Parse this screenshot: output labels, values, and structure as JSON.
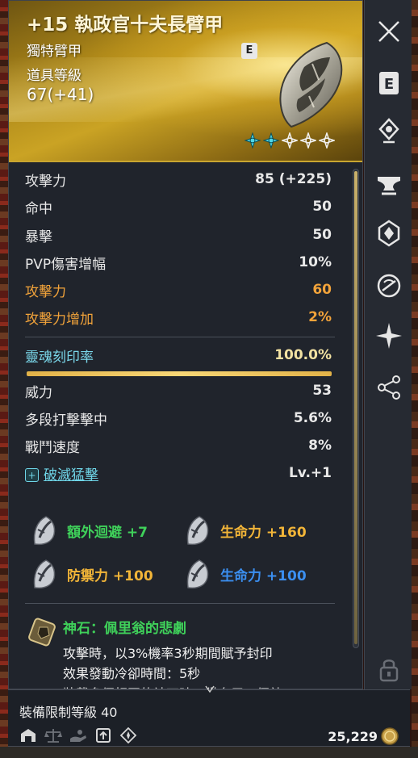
{
  "item": {
    "title": "+15 執政官十夫長臂甲",
    "type": "獨特臂甲",
    "level_label": "道具等級",
    "level_value": "67(+41)",
    "badge": "E",
    "stars_filled": 2,
    "stars_total": 5
  },
  "stats": {
    "base": [
      {
        "label": "攻擊力",
        "value": "85 (+225)"
      },
      {
        "label": "命中",
        "value": "50"
      },
      {
        "label": "暴擊",
        "value": "50"
      },
      {
        "label": "PVP傷害增幅",
        "value": "10%"
      }
    ],
    "bonus": [
      {
        "label": "攻擊力",
        "value": "60"
      },
      {
        "label": "攻擊力增加",
        "value": "2%"
      }
    ],
    "soul_label": "靈魂刻印率",
    "soul_value": "100.0%",
    "soul_progress": 1.0,
    "soul_stats": [
      {
        "label": "威力",
        "value": "53"
      },
      {
        "label": "多段打擊擊中",
        "value": "5.6%"
      },
      {
        "label": "戰鬥速度",
        "value": "8%"
      }
    ],
    "skill_label": "破滅猛擊",
    "skill_value": "Lv.+1"
  },
  "crystals": [
    {
      "label": "額外迴避 +7"
    },
    {
      "label": "生命力 +160"
    },
    {
      "label": "防禦力 +100"
    },
    {
      "label": "生命力 +100"
    }
  ],
  "godstone": {
    "title": "神石：佩里翁的悲劇",
    "lines": [
      "攻擊時，以3%機率3秒期間賦予封印",
      "效果發動冷卻時間：5秒",
      "裝載多個相同的神石時，僅套用一個效"
    ]
  },
  "footer": {
    "requirement": "裝備限制等級 40",
    "price": "25,229",
    "icons": [
      "warehouse-icon",
      "scale-icon",
      "hand-icon",
      "upgrade-icon",
      "compass-icon"
    ]
  },
  "sidebar": [
    "close-icon",
    "e-icon",
    "pin-icon",
    "anvil-icon",
    "crest-icon",
    "ring-icon",
    "sparkle-icon",
    "share-icon",
    "lock-icon"
  ],
  "colors": {
    "header_gold": "#caa324",
    "orange": "#f2a33a",
    "cyan": "#7ad7ea",
    "green": "#3fd15a",
    "gold_text": "#f2b538",
    "blue": "#3b8ff0"
  }
}
